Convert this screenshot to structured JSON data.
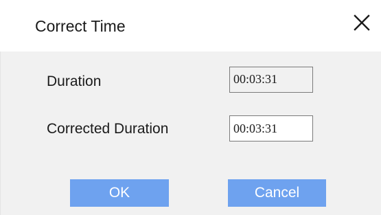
{
  "dialog": {
    "title": "Correct Time",
    "close_icon": "close-icon"
  },
  "form": {
    "duration_label": "Duration",
    "duration_value": "00:03:31",
    "corrected_label": "Corrected Duration",
    "corrected_value": "00:03:31"
  },
  "buttons": {
    "ok_label": "OK",
    "cancel_label": "Cancel"
  },
  "colors": {
    "button_bg": "#6ea2ef",
    "body_bg": "#f1f1f1"
  }
}
